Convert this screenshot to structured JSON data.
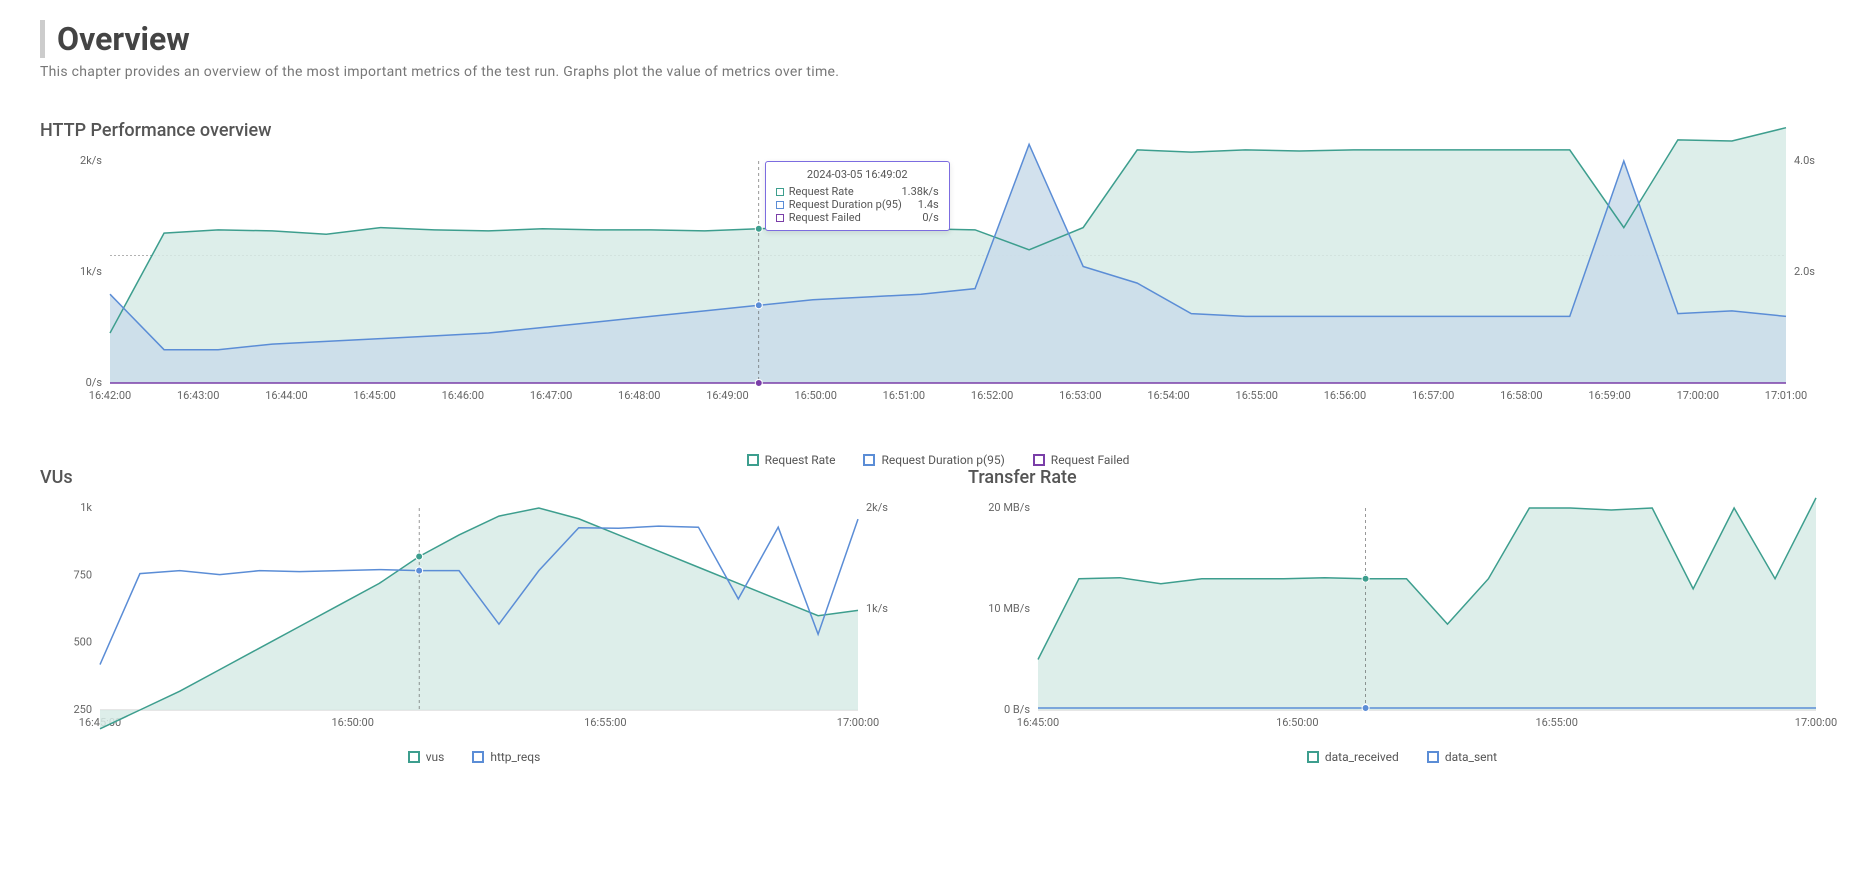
{
  "header": {
    "title": "Overview",
    "subtitle": "This chapter provides an overview of the most important metrics of the test run. Graphs plot the value of metrics over time."
  },
  "colors": {
    "rate": "#3d9e8e",
    "duration": "#5b8dd6",
    "failed": "#7a3ea8",
    "rate_fill": "#d7ebe6",
    "duration_fill": "#cadcea"
  },
  "chart_data": [
    {
      "id": "http_perf",
      "title": "HTTP Performance overview",
      "type": "line",
      "x_ticks": [
        "16:42:00",
        "16:43:00",
        "16:44:00",
        "16:45:00",
        "16:46:00",
        "16:47:00",
        "16:48:00",
        "16:49:00",
        "16:50:00",
        "16:51:00",
        "16:52:00",
        "16:53:00",
        "16:54:00",
        "16:55:00",
        "16:56:00",
        "16:57:00",
        "16:58:00",
        "16:59:00",
        "17:00:00",
        "17:01:00"
      ],
      "y_left": {
        "label": "/s",
        "ticks": [
          0,
          1000,
          2000
        ],
        "tick_labels": [
          "0/s",
          "1k/s",
          "2k/s"
        ]
      },
      "y_right": {
        "label": "s",
        "ticks": [
          2.0,
          4.0
        ],
        "tick_labels": [
          "2.0s",
          "4.0s"
        ]
      },
      "series": [
        {
          "name": "Request Rate",
          "axis": "left",
          "color": "#3d9e8e",
          "fill": "#d7ebe6",
          "values": [
            450,
            1350,
            1380,
            1370,
            1340,
            1400,
            1380,
            1370,
            1390,
            1380,
            1380,
            1370,
            1390,
            1400,
            1380,
            1390,
            1380,
            1200,
            1400,
            2100,
            2080,
            2100,
            2090,
            2100,
            2100,
            2100,
            2100,
            2100,
            1400,
            2190,
            2180,
            2300
          ]
        },
        {
          "name": "Request Duration p(95)",
          "axis": "right",
          "color": "#5b8dd6",
          "fill": "#cadcea",
          "values": [
            1.6,
            0.6,
            0.6,
            0.7,
            0.75,
            0.8,
            0.85,
            0.9,
            1.0,
            1.1,
            1.2,
            1.3,
            1.4,
            1.5,
            1.55,
            1.6,
            1.7,
            4.3,
            2.1,
            1.8,
            1.25,
            1.2,
            1.2,
            1.2,
            1.2,
            1.2,
            1.2,
            1.2,
            4.0,
            1.25,
            1.3,
            1.2
          ]
        },
        {
          "name": "Request Failed",
          "axis": "left",
          "color": "#7a3ea8",
          "fill": "none",
          "values": [
            0,
            0,
            0,
            0,
            0,
            0,
            0,
            0,
            0,
            0,
            0,
            0,
            0,
            0,
            0,
            0,
            0,
            0,
            0,
            0,
            0,
            0,
            0,
            0,
            0,
            0,
            0,
            0,
            0,
            0,
            0,
            0
          ]
        }
      ],
      "cursor": {
        "x_index": 12,
        "time": "2024-03-05 16:49:02",
        "rows": [
          {
            "label": "Request Rate",
            "value": "1.38k/s",
            "color": "#3d9e8e"
          },
          {
            "label": "Request Duration p(95)",
            "value": "1.4s",
            "color": "#5b8dd6"
          },
          {
            "label": "Request Failed",
            "value": "0/s",
            "color": "#7a3ea8"
          }
        ]
      },
      "legend": [
        {
          "label": "Request Rate",
          "color": "#3d9e8e"
        },
        {
          "label": "Request Duration p(95)",
          "color": "#5b8dd6"
        },
        {
          "label": "Request Failed",
          "color": "#7a3ea8"
        }
      ]
    },
    {
      "id": "vus",
      "title": "VUs",
      "type": "line",
      "x_ticks": [
        "16:45:00",
        "16:50:00",
        "16:55:00",
        "17:00:00"
      ],
      "y_left": {
        "ticks": [
          250,
          500,
          750,
          1000
        ],
        "tick_labels": [
          "250",
          "500",
          "750",
          "1k"
        ]
      },
      "y_right": {
        "ticks": [
          1000,
          2000
        ],
        "tick_labels": [
          "1k/s",
          "2k/s"
        ]
      },
      "series": [
        {
          "name": "vus",
          "axis": "left",
          "color": "#3d9e8e",
          "fill": "#d7ebe6",
          "values": [
            180,
            250,
            320,
            400,
            480,
            560,
            640,
            720,
            820,
            900,
            970,
            1000,
            960,
            900,
            840,
            780,
            720,
            660,
            600,
            620
          ]
        },
        {
          "name": "http_reqs",
          "axis": "right",
          "color": "#5b8dd6",
          "fill": "none",
          "values": [
            450,
            1350,
            1380,
            1340,
            1380,
            1370,
            1380,
            1390,
            1380,
            1380,
            850,
            1380,
            1805,
            1800,
            1820,
            1810,
            1100,
            1810,
            750,
            1890
          ]
        }
      ],
      "cursor": {
        "x_index": 8
      },
      "legend": [
        {
          "label": "vus",
          "color": "#3d9e8e"
        },
        {
          "label": "http_reqs",
          "color": "#5b8dd6"
        }
      ]
    },
    {
      "id": "transfer",
      "title": "Transfer Rate",
      "type": "line",
      "x_ticks": [
        "16:45:00",
        "16:50:00",
        "16:55:00",
        "17:00:00"
      ],
      "y_left": {
        "ticks": [
          0,
          10,
          20
        ],
        "tick_labels": [
          "0 B/s",
          "10 MB/s",
          "20 MB/s"
        ]
      },
      "y_right": null,
      "series": [
        {
          "name": "data_received",
          "axis": "left",
          "color": "#3d9e8e",
          "fill": "#d7ebe6",
          "values": [
            5,
            13,
            13.1,
            12.5,
            13.0,
            13.0,
            13.0,
            13.1,
            13.0,
            13.0,
            8.5,
            13.0,
            20,
            20,
            19.8,
            20,
            12.0,
            20,
            13,
            21
          ]
        },
        {
          "name": "data_sent",
          "axis": "left",
          "color": "#5b8dd6",
          "fill": "none",
          "values": [
            0.2,
            0.2,
            0.2,
            0.2,
            0.2,
            0.2,
            0.2,
            0.2,
            0.2,
            0.2,
            0.2,
            0.2,
            0.2,
            0.2,
            0.2,
            0.2,
            0.2,
            0.2,
            0.2,
            0.2
          ]
        }
      ],
      "cursor": {
        "x_index": 8
      },
      "legend": [
        {
          "label": "data_received",
          "color": "#3d9e8e"
        },
        {
          "label": "data_sent",
          "color": "#5b8dd6"
        }
      ]
    }
  ]
}
